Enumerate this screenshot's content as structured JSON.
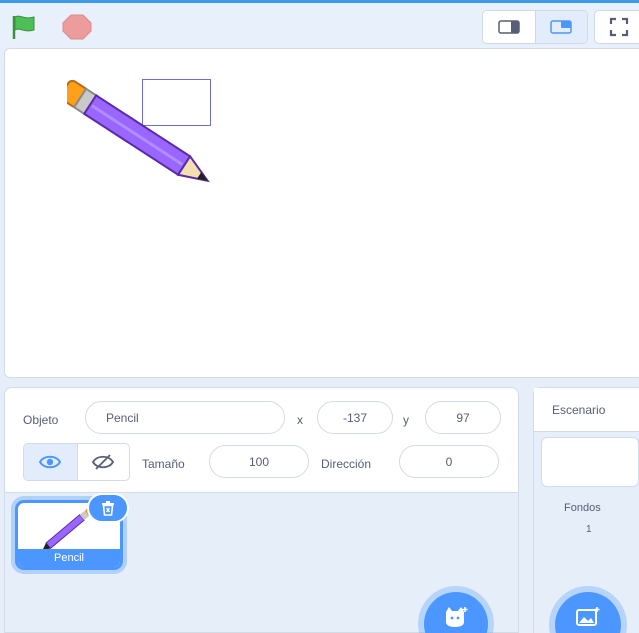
{
  "toolbar": {
    "green_flag_icon": "green-flag-icon",
    "stop_icon": "stop-icon",
    "small_stage_icon": "small-stage-icon",
    "normal_stage_icon": "normal-stage-icon",
    "fullscreen_icon": "fullscreen-icon"
  },
  "sprite_info": {
    "object_label": "Objeto",
    "object_name": "Pencil",
    "x_label": "x",
    "x_value": "-137",
    "y_label": "y",
    "y_value": "97",
    "size_label": "Tamaño",
    "size_value": "100",
    "direction_label": "Dirección",
    "direction_value": "0"
  },
  "sprites": [
    {
      "name": "Pencil",
      "selected": true
    }
  ],
  "stage_panel": {
    "title": "Escenario",
    "backdrops_label": "Fondos",
    "backdrops_count": "1"
  },
  "colors": {
    "accent": "#4c97ff",
    "flag": "#4cbf56",
    "stop": "#ec9c9c",
    "pencil_body": "#9966ff",
    "pencil_eraser": "#ff9f1a"
  }
}
